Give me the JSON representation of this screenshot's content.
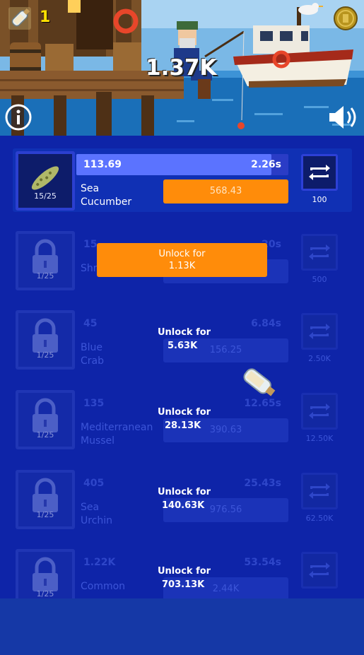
{
  "hud": {
    "bottles_count": "1",
    "money": "1.37K"
  },
  "unlock_button": {
    "line1": "Unlock for",
    "line2": "1.13K"
  },
  "items": [
    {
      "count": "15/25",
      "level": "113.69",
      "time": "2.26s",
      "name1": "Sea",
      "name2": "Cucumber",
      "sell": "568.43",
      "swap_price": "100",
      "progress": 0.92
    },
    {
      "count": "1/25",
      "level": "15",
      "time": "20s",
      "name1": "Shrimp",
      "name2": "",
      "sell": "",
      "swap_price": "500"
    },
    {
      "count": "1/25",
      "level": "45",
      "time": "6.84s",
      "name1": "Blue",
      "name2": "Crab",
      "sell": "156.25",
      "swap_price": "2.50K",
      "unlock1": "Unlock for",
      "unlock2": "5.63K"
    },
    {
      "count": "1/25",
      "level": "135",
      "time": "12.65s",
      "name1": "Mediterranean",
      "name2": "Mussel",
      "sell": "390.63",
      "swap_price": "12.50K",
      "unlock1": "Unlock for",
      "unlock2": "28.13K"
    },
    {
      "count": "1/25",
      "level": "405",
      "time": "25.43s",
      "name1": "Sea",
      "name2": "Urchin",
      "sell": "976.56",
      "swap_price": "62.50K",
      "unlock1": "Unlock for",
      "unlock2": "140.63K"
    },
    {
      "count": "1/25",
      "level": "1.22K",
      "time": "53.54s",
      "name1": "Common",
      "name2": "",
      "sell": "2.44K",
      "swap_price": "",
      "unlock1": "Unlock for",
      "unlock2": "703.13K"
    }
  ],
  "colors": {
    "panel": "#0e24a8",
    "accent": "#ff8c0a",
    "bar": "#5b73ff"
  }
}
